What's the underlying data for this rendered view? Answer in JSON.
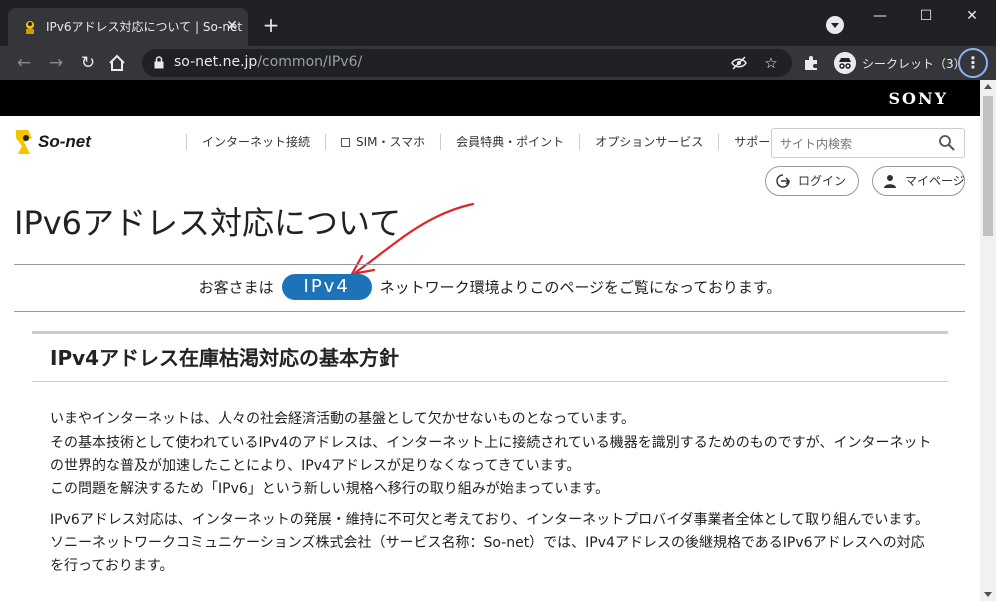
{
  "browser": {
    "tab_title": "IPv6アドレス対応について | So-net",
    "tab_close": "✕",
    "new_tab": "+",
    "url_host": "so-net.ne.jp",
    "url_path": "/common/IPv6/",
    "incognito_label": "シークレット（3）",
    "window_controls": {
      "minimize": "—",
      "maximize": "☐",
      "close": "✕"
    }
  },
  "header": {
    "sony_logo": "SONY",
    "sonet_logo": "So-net",
    "nav": [
      {
        "label": "インターネット接続"
      },
      {
        "label": "SIM・スマホ"
      },
      {
        "label": "会員特典・ポイント"
      },
      {
        "label": "オプションサービス"
      },
      {
        "label": "サポート"
      }
    ],
    "search_placeholder": "サイト内検索",
    "login_label": "ログイン",
    "mypage_label": "マイページ"
  },
  "main": {
    "title": "IPv6アドレス対応について",
    "notice_prefix": "お客さまは",
    "ip_version": "IPv4",
    "notice_suffix": "ネットワーク環境よりこのページをご覧になっております。",
    "section_title": "IPv4アドレス在庫枯渇対応の基本方針",
    "paragraphs": [
      "いまやインターネットは、人々の社会経済活動の基盤として欠かせないものとなっています。",
      "その基本技術として使われているIPv4のアドレスは、インターネット上に接続されている機器を識別するためのものですが、インターネット",
      "の世界的な普及が加速したことにより、IPv4アドレスが足りなくなってきています。",
      "この問題を解決するため「IPv6」という新しい規格へ移行の取り組みが始まっています。",
      "IPv6アドレス対応は、インターネットの発展・維持に不可欠と考えており、インターネットプロバイダ事業者全体として取り組んでいます。",
      "ソニーネットワークコミュニケーションズ株式会社（サービス名称：So-net）では、IPv4アドレスの後継規格であるIPv6アドレスへの対応",
      "を行っております。"
    ]
  },
  "colors": {
    "badge": "#1d73b8",
    "annotation_arrow": "#e0262a",
    "sonet_yellow": "#f5c400"
  }
}
